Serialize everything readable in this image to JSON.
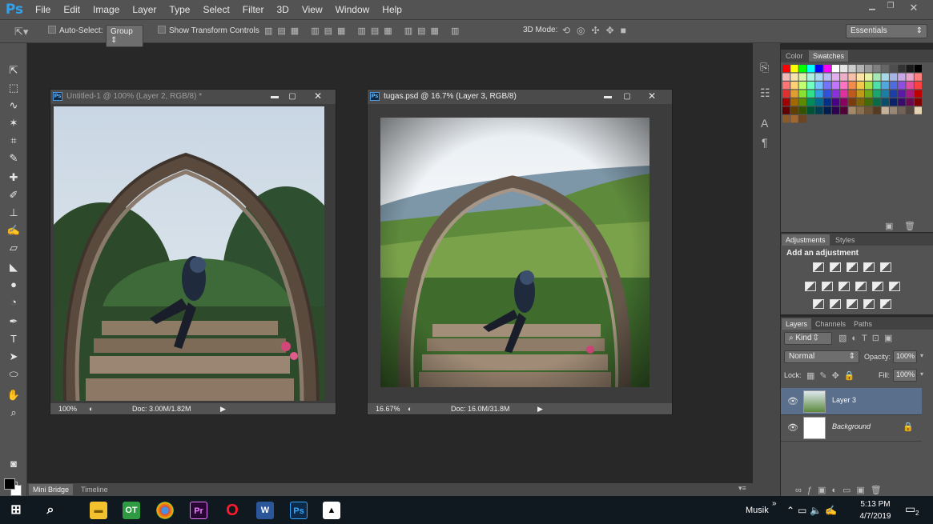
{
  "app": {
    "logo": "Ps",
    "menu": [
      "File",
      "Edit",
      "Image",
      "Layer",
      "Type",
      "Select",
      "Filter",
      "3D",
      "View",
      "Window",
      "Help"
    ]
  },
  "options": {
    "auto_select_label": "Auto-Select:",
    "auto_select_value": "Group",
    "show_transform_label": "Show Transform Controls",
    "mode_3d_label": "3D Mode:",
    "workspace": "Essentials"
  },
  "doc1": {
    "title": "Untitled-1 @ 100% (Layer 2, RGB/8) *",
    "zoom": "100%",
    "doc_size": "Doc: 3.00M/1.82M"
  },
  "doc2": {
    "title": "tugas.psd @ 16.7% (Layer 3, RGB/8)",
    "zoom": "16.67%",
    "doc_size": "Doc: 16.0M/31.8M"
  },
  "panels": {
    "color_tabs": [
      "Color",
      "Swatches"
    ],
    "adj_tabs": [
      "Adjustments",
      "Styles"
    ],
    "adj_heading": "Add an adjustment",
    "layer_tabs": [
      "Layers",
      "Channels",
      "Paths"
    ],
    "kind": "Kind",
    "blend_mode": "Normal",
    "opacity_label": "Opacity:",
    "opacity_value": "100%",
    "lock_label": "Lock:",
    "fill_label": "Fill:",
    "fill_value": "100%",
    "layers": [
      {
        "name": "Layer 3",
        "selected": true
      },
      {
        "name": "Background",
        "selected": false
      }
    ]
  },
  "bottom_tabs": [
    "Mini Bridge",
    "Timeline"
  ],
  "taskbar": {
    "tray_label": "Musik",
    "time": "5:13 PM",
    "date": "4/7/2019",
    "notifications": "2"
  },
  "colors": {
    "ui_panel": "#535353",
    "workspace": "#282828",
    "ps_blue": "#2fa3f0",
    "selected_layer": "#5a6f8c"
  }
}
